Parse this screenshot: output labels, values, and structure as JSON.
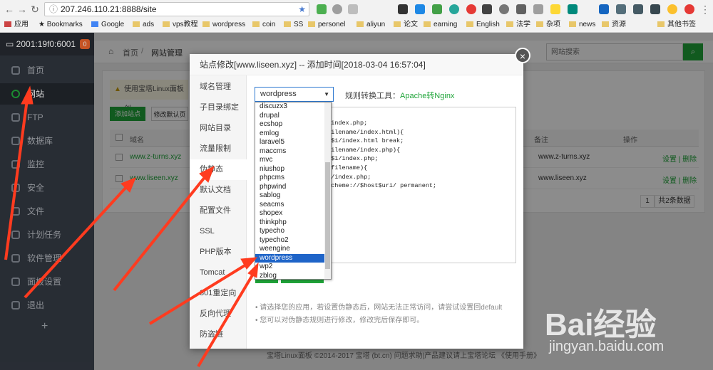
{
  "browser": {
    "url": "207.246.110.21:8888/site",
    "bookmarks": [
      "应用",
      "Bookmarks",
      "Google",
      "ads",
      "vps教程",
      "wordpress",
      "coin",
      "SS",
      "personel",
      "aliyun",
      "论文",
      "earning",
      "English",
      "法学",
      "杂项",
      "news",
      "资源",
      "其他书签"
    ]
  },
  "sidebar": {
    "server": "2001:19f0:6001",
    "badge": "0",
    "items": [
      "首页",
      "网站",
      "FTP",
      "数据库",
      "监控",
      "安全",
      "文件",
      "计划任务",
      "软件管理",
      "面板设置",
      "退出"
    ],
    "add": "+"
  },
  "topbar": {
    "home": "首页",
    "sep": "/",
    "current": "网站管理",
    "search_placeholder": "网站搜索"
  },
  "panel": {
    "notice": "使用宝塔Linux面板创",
    "add_site": "添加站点",
    "default_page": "修改默认页",
    "col_name": "域名",
    "col_note": "备注",
    "col_ops": "操作",
    "rows": [
      {
        "name": "www.z-turns.xyz",
        "note": "www.z-turns.xyz",
        "ops": "设置 | 删除"
      },
      {
        "name": "www.liseen.xyz",
        "note": "www.liseen.xyz",
        "ops": "设置 | 删除"
      }
    ],
    "pager_page": "1",
    "pager_total": "共2条数据"
  },
  "dialog": {
    "title": "站点修改[www.liseen.xyz] -- 添加时间[2018-03-04 16:57:04]",
    "close": "×",
    "nav": [
      "域名管理",
      "子目录绑定",
      "网站目录",
      "流量限制",
      "伪静态",
      "默认文档",
      "配置文件",
      "SSL",
      "PHP版本",
      "Tomcat",
      "301重定向",
      "反向代理",
      "防盗链"
    ],
    "select_value": "wordpress",
    "rule_tool_label": "规则转换工具：",
    "rule_tool_link": "Apache转Nginx",
    "options": [
      "discuzx3",
      "drupal",
      "ecshop",
      "emlog",
      "laravel5",
      "maccms",
      "mvc",
      "niushop",
      "phpcms",
      "phpwind",
      "sablog",
      "seacms",
      "shopex",
      "thinkphp",
      "typecho",
      "typecho2",
      "weengine",
      "wordpress",
      "wp2",
      "zblog"
    ],
    "code_lines": [
      "l index.php;",
      "_filename/index.html){",
      ") $1/index.html break;",
      "",
      "_filename/index.php){",
      ") $1/index.php;",
      "",
      "t_filename){",
      ") /index.php;",
      "",
      "",
      "",
      "$scheme://$host$uri/ permanent;"
    ],
    "notes": [
      "请选择您的应用，若设置伪静态后，网站无法正常访问，请尝试设置回default",
      "您可以对伪静态规则进行修改，修改完后保存即可。"
    ]
  },
  "footer": "宝塔Linux面板 ©2014-2017 宝塔 (bt.cn)   问题求助|产品建议请上宝塔论坛   《使用手册》",
  "watermark": {
    "logo": "Bai经验",
    "url": "jingyan.baidu.com"
  },
  "colors": {
    "accent": "#20a53a",
    "sidebar": "#30353e",
    "annotation": "#ff3b1f"
  }
}
